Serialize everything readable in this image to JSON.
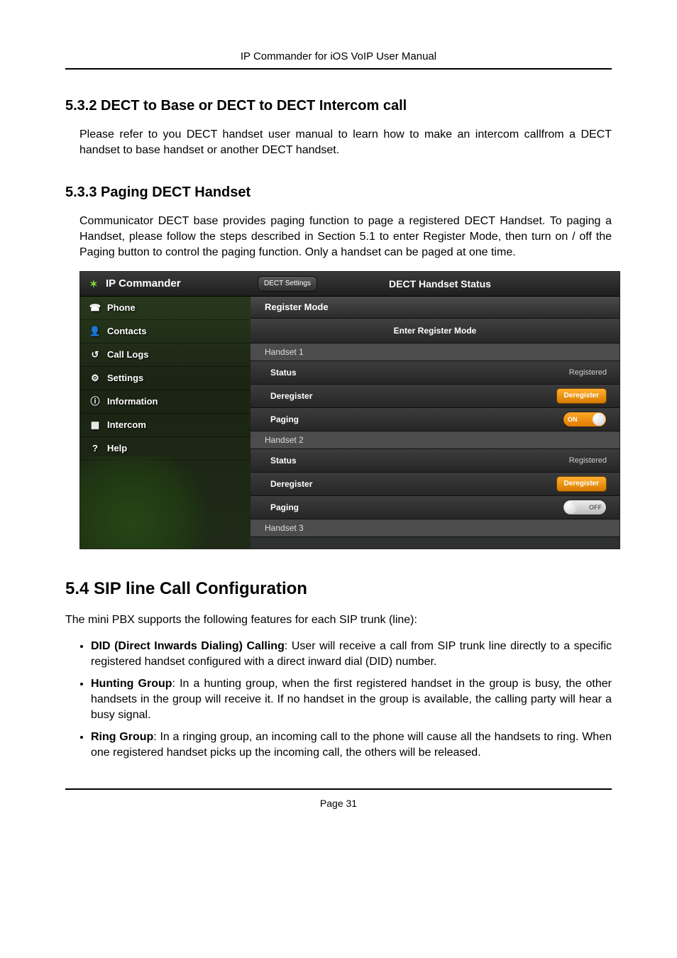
{
  "doc_header": "IP Commander for iOS VoIP User Manual",
  "section_532": {
    "heading": "5.3.2 DECT to Base or DECT to DECT Intercom call",
    "body": "Please refer to you DECT handset user manual to learn how to make an intercom callfrom a DECT handset to base handset or another DECT handset."
  },
  "section_533": {
    "heading": "5.3.3 Paging DECT Handset",
    "body": "Communicator DECT base provides paging function to page a registered DECT Handset.   To paging a Handset, please follow the steps described in Section 5.1 to enter Register Mode, then turn on / off the Paging button to control the paging function.  Only a handset can be paged at one time."
  },
  "screenshot": {
    "brand": "IP Commander",
    "nav": {
      "phone": "Phone",
      "contacts": "Contacts",
      "call_logs": "Call Logs",
      "settings": "Settings",
      "information": "Information",
      "intercom": "Intercom",
      "help": "Help"
    },
    "back_label": "DECT Settings",
    "title": "DECT Handset Status",
    "register_mode_hdr": "Register Mode",
    "enter_register_mode": "Enter Register Mode",
    "labels": {
      "status": "Status",
      "deregister": "Deregister",
      "paging": "Paging",
      "registered": "Registered",
      "dereg_btn": "Deregister",
      "on": "ON",
      "off": "OFF"
    },
    "handsets": [
      {
        "name": "Handset 1",
        "status": "Registered",
        "paging": "on"
      },
      {
        "name": "Handset 2",
        "status": "Registered",
        "paging": "off"
      },
      {
        "name": "Handset 3"
      }
    ]
  },
  "section_54": {
    "heading": "5.4   SIP line Call Configuration",
    "intro": "The mini PBX supports the following features for each SIP trunk (line):",
    "items": [
      {
        "title": "DID (Direct Inwards Dialing) Calling",
        "rest": ": User will receive a call from SIP trunk line directly to a specific registered handset configured with a direct inward dial (DID) number."
      },
      {
        "title": "Hunting Group",
        "rest": ": In a hunting group, when the first registered handset in the group is busy, the other handsets in the group will receive it. If no handset in the group is available, the calling party will hear a busy signal."
      },
      {
        "title": "Ring Group",
        "rest": ": In a ringing group, an incoming call to the phone will cause all the handsets to ring. When one registered handset picks up the incoming call, the others will be released."
      }
    ]
  },
  "footer": "Page    31"
}
